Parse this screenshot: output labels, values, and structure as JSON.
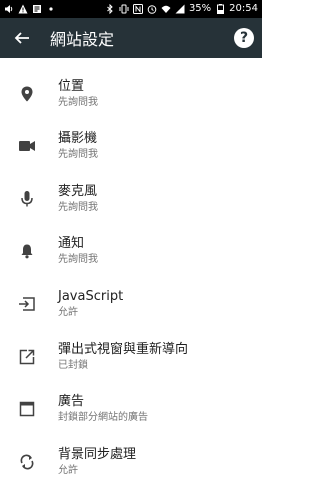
{
  "status_bar": {
    "battery": "35%",
    "time": "20:54"
  },
  "toolbar": {
    "title": "網站設定",
    "help_label": "?"
  },
  "items": [
    {
      "icon": "location-pin-icon",
      "title": "位置",
      "subtitle": "先詢問我"
    },
    {
      "icon": "camera-icon",
      "title": "攝影機",
      "subtitle": "先詢問我"
    },
    {
      "icon": "microphone-icon",
      "title": "麥克風",
      "subtitle": "先詢問我"
    },
    {
      "icon": "bell-icon",
      "title": "通知",
      "subtitle": "先詢問我"
    },
    {
      "icon": "javascript-icon",
      "title": "JavaScript",
      "subtitle": "允許"
    },
    {
      "icon": "popup-icon",
      "title": "彈出式視窗與重新導向",
      "subtitle": "已封鎖"
    },
    {
      "icon": "ads-icon",
      "title": "廣告",
      "subtitle": "封鎖部分網站的廣告"
    },
    {
      "icon": "sync-icon",
      "title": "背景同步處理",
      "subtitle": "允許"
    }
  ]
}
